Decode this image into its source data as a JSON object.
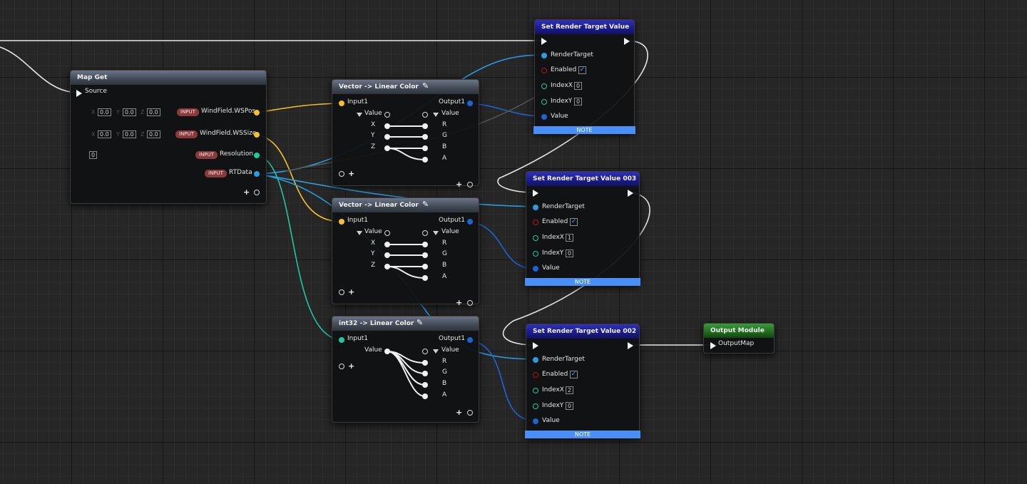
{
  "nodes": {
    "map_get": {
      "title": "Map Get",
      "source_label": "Source",
      "rows": [
        {
          "badge": "INPUT",
          "label": "WindField.WSPos",
          "x": "0.0",
          "y": "0.0",
          "z": "0.0"
        },
        {
          "badge": "INPUT",
          "label": "WindField.WSSize",
          "x": "0.0",
          "y": "0.0",
          "z": "0.0"
        },
        {
          "badge": "INPUT",
          "label": "Resolution",
          "value": "0"
        },
        {
          "badge": "INPUT",
          "label": "RTData"
        }
      ],
      "axis": {
        "x": "X",
        "y": "Y",
        "z": "Z"
      }
    },
    "vec1": {
      "title": "Vector -> Linear Color",
      "input": "Input1",
      "output": "Output1",
      "value_in": "Value",
      "value_out": "Value",
      "in_fields": [
        "X",
        "Y",
        "Z"
      ],
      "out_fields": [
        "R",
        "G",
        "B",
        "A"
      ]
    },
    "vec2": {
      "title": "Vector -> Linear Color",
      "input": "Input1",
      "output": "Output1",
      "value_in": "Value",
      "value_out": "Value",
      "in_fields": [
        "X",
        "Y",
        "Z"
      ],
      "out_fields": [
        "R",
        "G",
        "B",
        "A"
      ]
    },
    "int32": {
      "title": "int32 -> Linear Color",
      "input": "Input1",
      "output": "Output1",
      "value_in": "Value",
      "value_out": "Value",
      "out_fields": [
        "R",
        "G",
        "B",
        "A"
      ]
    },
    "srt1": {
      "title": "Set Render Target Value",
      "render_target": "RenderTarget",
      "enabled": "Enabled",
      "index_x": "IndexX",
      "index_x_val": "0",
      "index_y": "IndexY",
      "index_y_val": "0",
      "value": "Value",
      "note": "NOTE"
    },
    "srt3": {
      "title": "Set Render Target Value 003",
      "render_target": "RenderTarget",
      "enabled": "Enabled",
      "index_x": "IndexX",
      "index_x_val": "1",
      "index_y": "IndexY",
      "index_y_val": "0",
      "value": "Value",
      "note": "NOTE"
    },
    "srt2": {
      "title": "Set Render Target Value 002",
      "render_target": "RenderTarget",
      "enabled": "Enabled",
      "index_x": "IndexX",
      "index_x_val": "2",
      "index_y": "IndexY",
      "index_y_val": "0",
      "value": "Value",
      "note": "NOTE"
    },
    "output": {
      "title": "Output Module",
      "pin": "OutputMap"
    }
  },
  "icons": {
    "check": "✓",
    "plus": "+",
    "pencil": "✎"
  },
  "colors": {
    "vector_pin": "#f6c128",
    "rtdata_pin": "#2b9ce0",
    "color_pin": "#1c64d4",
    "int_pin": "#20c8a0",
    "note_bar": "#4a8ef8",
    "exec_wire": "#e8e8e8"
  }
}
